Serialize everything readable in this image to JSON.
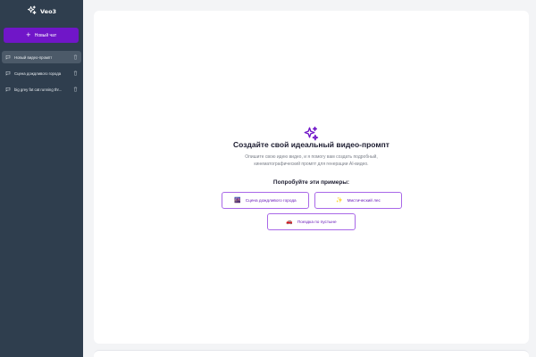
{
  "app": {
    "name": "Veo3"
  },
  "sidebar": {
    "new_chat_label": "Новый чат",
    "chats": [
      {
        "title": "Новый видео-промпт"
      },
      {
        "title": "Сцена дождливого города"
      },
      {
        "title": "big grey fat cat running thr..."
      }
    ]
  },
  "main": {
    "heading": "Создайте свой идеальный видео-промпт",
    "description_line1": "Опишите свою идею видео, и я помогу вам создать подробный,",
    "description_line2": "кинематографический промпт для генерации AI-видео.",
    "examples_title": "Попробуйте эти примеры:",
    "examples": [
      {
        "icon": "🌆",
        "label": "Сцена дождливого города"
      },
      {
        "icon": "✨",
        "label": "Мистический лес"
      },
      {
        "icon": "🚗",
        "label": "Поездка по пустыне"
      }
    ]
  },
  "colors": {
    "sidebar_bg": "#2f3e4e",
    "accent": "#7016c8",
    "active_item": "#4c5a69"
  }
}
